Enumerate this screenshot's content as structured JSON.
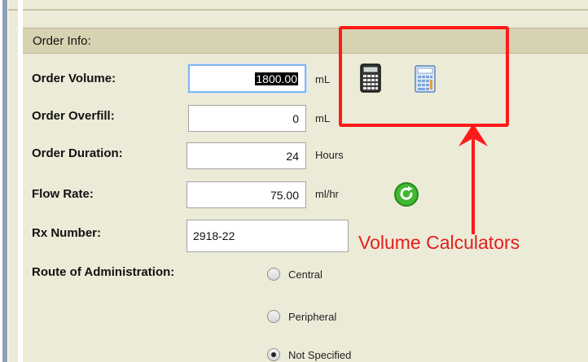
{
  "section": {
    "title": "Order Info:"
  },
  "fields": {
    "order_volume": {
      "label": "Order Volume:",
      "value": "1800.00",
      "unit": "mL"
    },
    "order_overfill": {
      "label": "Order Overfill:",
      "value": "0",
      "unit": "mL"
    },
    "order_duration": {
      "label": "Order Duration:",
      "value": "24",
      "unit": "Hours"
    },
    "flow_rate": {
      "label": "Flow Rate:",
      "value": "75.00",
      "unit": "ml/hr"
    },
    "rx_number": {
      "label": "Rx Number:",
      "value": "2918-22"
    }
  },
  "route": {
    "label": "Route of Administration:",
    "options": [
      "Central",
      "Peripheral",
      "Not Specified"
    ],
    "selected": "Not Specified"
  },
  "icons": {
    "calculator_dark": "calculator-icon",
    "calculator_blue": "calculator-icon",
    "refresh": "refresh-icon"
  },
  "annotation": {
    "text": "Volume Calculators",
    "color": "#e51d1d"
  }
}
